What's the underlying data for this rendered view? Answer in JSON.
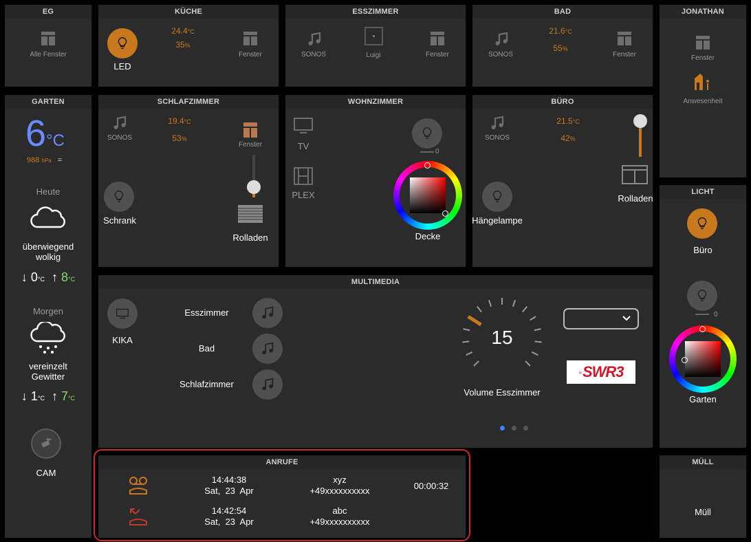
{
  "panels": {
    "eg": {
      "title": "EG",
      "label": "Alle Fenster"
    },
    "kueche": {
      "title": "KÜCHE",
      "light": "LED",
      "temp": "24.4",
      "temp_unit": "°C",
      "hum": "35",
      "hum_unit": "%",
      "window": "Fenster"
    },
    "esszimmer": {
      "title": "ESSZIMMER",
      "sonos": "SONOS",
      "luigi": "Luigi",
      "window": "Fenster"
    },
    "bad": {
      "title": "BAD",
      "sonos": "SONOS",
      "temp": "21.6",
      "temp_unit": "°C",
      "hum": "55",
      "hum_unit": "%",
      "window": "Fenster"
    },
    "jonathan": {
      "title": "JONATHAN",
      "window": "Fenster",
      "presence": "Anwesenheit"
    },
    "garten": {
      "title": "GARTEN",
      "temp": "6",
      "temp_unit": "°C",
      "pressure": "988",
      "pressure_unit": "hPa",
      "trend": "=",
      "today_label": "Heute",
      "today_desc": "überwiegend wolkig",
      "today_min": "0",
      "today_max": "8",
      "tomorrow_label": "Morgen",
      "tomorrow_desc": "vereinzelt Gewitter",
      "tomorrow_min": "1",
      "tomorrow_max": "7",
      "deg_unit": "°C",
      "cam": "CAM"
    },
    "schlafzimmer": {
      "title": "SCHLAFZIMMER",
      "sonos": "SONOS",
      "temp": "19.4",
      "temp_unit": "°C",
      "hum": "53",
      "hum_unit": "%",
      "window": "Fenster",
      "light": "Schrank",
      "shutter": "Rolladen",
      "slider_level": 0.25
    },
    "wohnzimmer": {
      "title": "WOHNZIMMER",
      "tv": "TV",
      "plex": "PLEX",
      "dimmer_value": "0",
      "light": "Decke"
    },
    "buero": {
      "title": "BÜRO",
      "sonos": "SONOS",
      "temp": "21.5",
      "temp_unit": "°C",
      "hum": "42",
      "hum_unit": "%",
      "light": "Hängelampe",
      "shutter": "Rolladen",
      "slider_level": 1.0
    },
    "licht": {
      "title": "LICHT",
      "light1": "Büro",
      "dimmer_value": "0",
      "light2": "Garten"
    },
    "multimedia": {
      "title": "MULTIMEDIA",
      "tv_label": "KIKA",
      "rooms": [
        "Esszimmer",
        "Bad",
        "Schlafzimmer"
      ],
      "volume": "15",
      "volume_label": "Volume Esszimmer",
      "volume_level": 0.15,
      "dropdown_value": "",
      "station_logo": "SWR3",
      "page_index": 0,
      "page_count": 3
    },
    "anrufe": {
      "title": "ANRUFE",
      "calls": [
        {
          "type": "voicemail-icon",
          "time": "14:44:38",
          "date": "Sat,  23  Apr",
          "name": "xyz",
          "number": "+49xxxxxxxxxx",
          "duration": "00:00:32"
        },
        {
          "type": "missed-call-icon",
          "time": "14:42:54",
          "date": "Sat,  23  Apr",
          "name": "abc",
          "number": "+49xxxxxxxxxx",
          "duration": ""
        }
      ]
    },
    "muell": {
      "title": "MÜLL",
      "label": "Müll"
    }
  },
  "colors": {
    "accent": "#c8791d",
    "temp_blue": "#6b8cff",
    "max_green": "#8bdc6a",
    "missed_red": "#c0392b",
    "highlight": "#d42828"
  }
}
